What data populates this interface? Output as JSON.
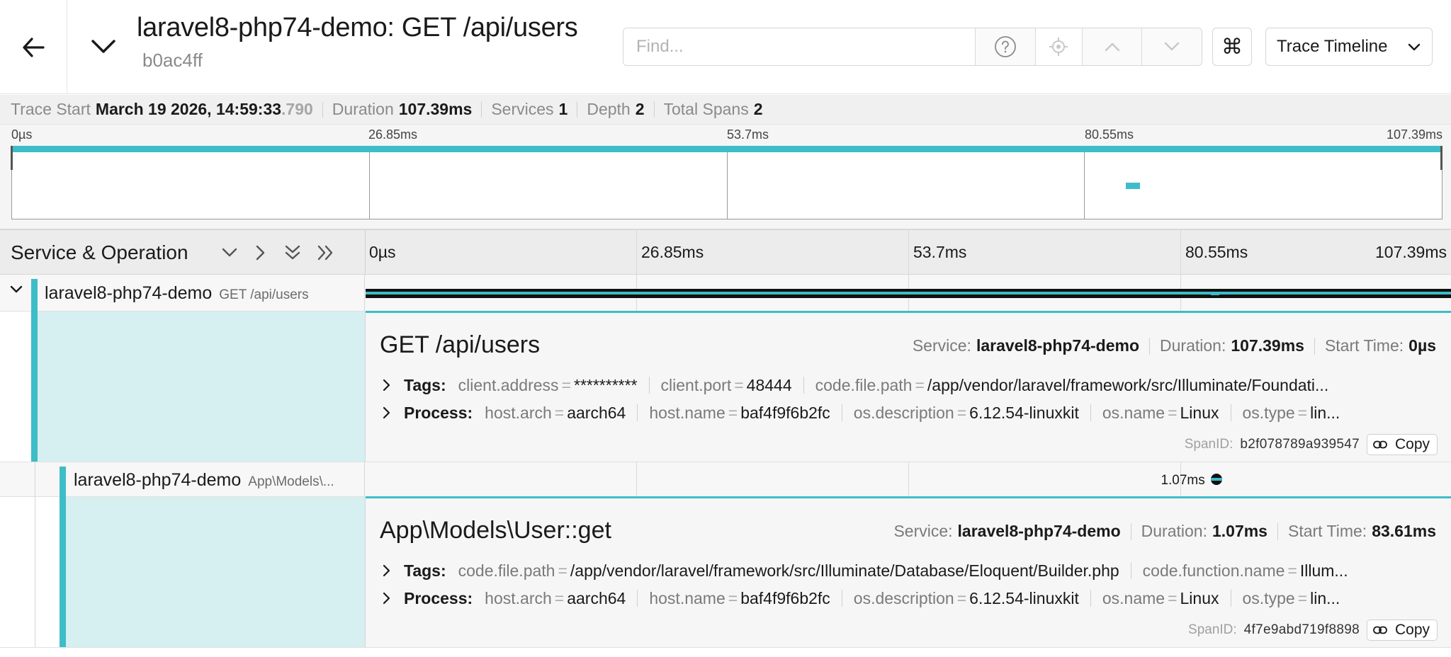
{
  "header": {
    "title": "laravel8-php74-demo: GET /api/users",
    "trace_id": "b0ac4ff",
    "find_placeholder": "Find...",
    "view_select": "Trace Timeline",
    "kbd_symbol": "⌘"
  },
  "summary": {
    "trace_start_label": "Trace Start",
    "trace_start_value": "March 19 2026, 14:59:33",
    "trace_start_ms": ".790",
    "duration_label": "Duration",
    "duration_value": "107.39ms",
    "services_label": "Services",
    "services_value": "1",
    "depth_label": "Depth",
    "depth_value": "2",
    "total_spans_label": "Total Spans",
    "total_spans_value": "2"
  },
  "minimap": {
    "ticks": [
      "0µs",
      "26.85ms",
      "53.7ms",
      "80.55ms",
      "107.39ms"
    ]
  },
  "timeline": {
    "column_label": "Service & Operation",
    "ticks": [
      "0µs",
      "26.85ms",
      "53.7ms",
      "80.55ms",
      "107.39ms"
    ]
  },
  "spans": [
    {
      "service": "laravel8-php74-demo",
      "operation": "GET /api/users",
      "title": "GET /api/users",
      "service_label": "Service:",
      "service_value": "laravel8-php74-demo",
      "duration_label": "Duration:",
      "duration_value": "107.39ms",
      "start_label": "Start Time:",
      "start_value": "0µs",
      "tags_label": "Tags:",
      "tags": [
        {
          "key": "client.address",
          "value": "**********"
        },
        {
          "key": "client.port",
          "value": "48444"
        },
        {
          "key": "code.file.path",
          "value": "/app/vendor/laravel/framework/src/Illuminate/Foundati..."
        }
      ],
      "process_label": "Process:",
      "process": [
        {
          "key": "host.arch",
          "value": "aarch64"
        },
        {
          "key": "host.name",
          "value": "baf4f9f6b2fc"
        },
        {
          "key": "os.description",
          "value": "6.12.54-linuxkit"
        },
        {
          "key": "os.name",
          "value": "Linux"
        },
        {
          "key": "os.type",
          "value": "lin..."
        }
      ],
      "spanid_label": "SpanID:",
      "spanid_value": "b2f078789a939547",
      "copy_label": "Copy",
      "start_ms": 0,
      "duration_ms": 107.39
    },
    {
      "service": "laravel8-php74-demo",
      "operation": "App\\Models\\...",
      "title": "App\\Models\\User::get",
      "bar_label": "1.07ms",
      "service_label": "Service:",
      "service_value": "laravel8-php74-demo",
      "duration_label": "Duration:",
      "duration_value": "1.07ms",
      "start_label": "Start Time:",
      "start_value": "83.61ms",
      "tags_label": "Tags:",
      "tags": [
        {
          "key": "code.file.path",
          "value": "/app/vendor/laravel/framework/src/Illuminate/Database/Eloquent/Builder.php"
        },
        {
          "key": "code.function.name",
          "value": "Illum..."
        }
      ],
      "process_label": "Process:",
      "process": [
        {
          "key": "host.arch",
          "value": "aarch64"
        },
        {
          "key": "host.name",
          "value": "baf4f9f6b2fc"
        },
        {
          "key": "os.description",
          "value": "6.12.54-linuxkit"
        },
        {
          "key": "os.name",
          "value": "Linux"
        },
        {
          "key": "os.type",
          "value": "lin..."
        }
      ],
      "spanid_label": "SpanID:",
      "spanid_value": "4f7e9abd719f8898",
      "copy_label": "Copy",
      "start_ms": 83.61,
      "duration_ms": 1.07
    }
  ],
  "colors": {
    "accent": "#3dbdc7",
    "span_bar_dark": "#111111",
    "detail_bg": "#f6f6f6",
    "row_left_bg": "#d6eff1"
  }
}
